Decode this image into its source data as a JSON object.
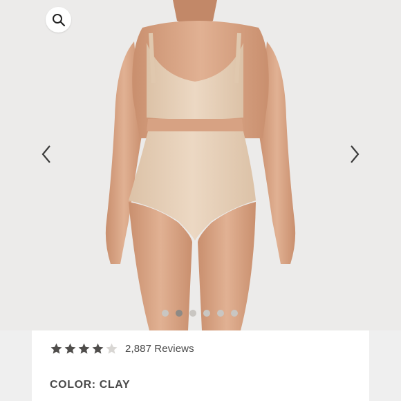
{
  "product": {
    "image_alt": "Model wearing nude bra and high-waist brief",
    "rating": 4,
    "rating_max": 5,
    "reviews_label": "2,887 Reviews",
    "color_label": "COLOR: CLAY"
  },
  "gallery": {
    "slide_count": 6,
    "active_index": 1
  },
  "icons": {
    "search": "search-icon",
    "prev": "chevron-left-icon",
    "next": "chevron-right-icon",
    "star": "star-icon"
  },
  "colors": {
    "star_filled": "#4f4d4b",
    "star_empty": "#d8d6d3",
    "fabric": "#e8d2bb",
    "skin": "#dba98a"
  }
}
